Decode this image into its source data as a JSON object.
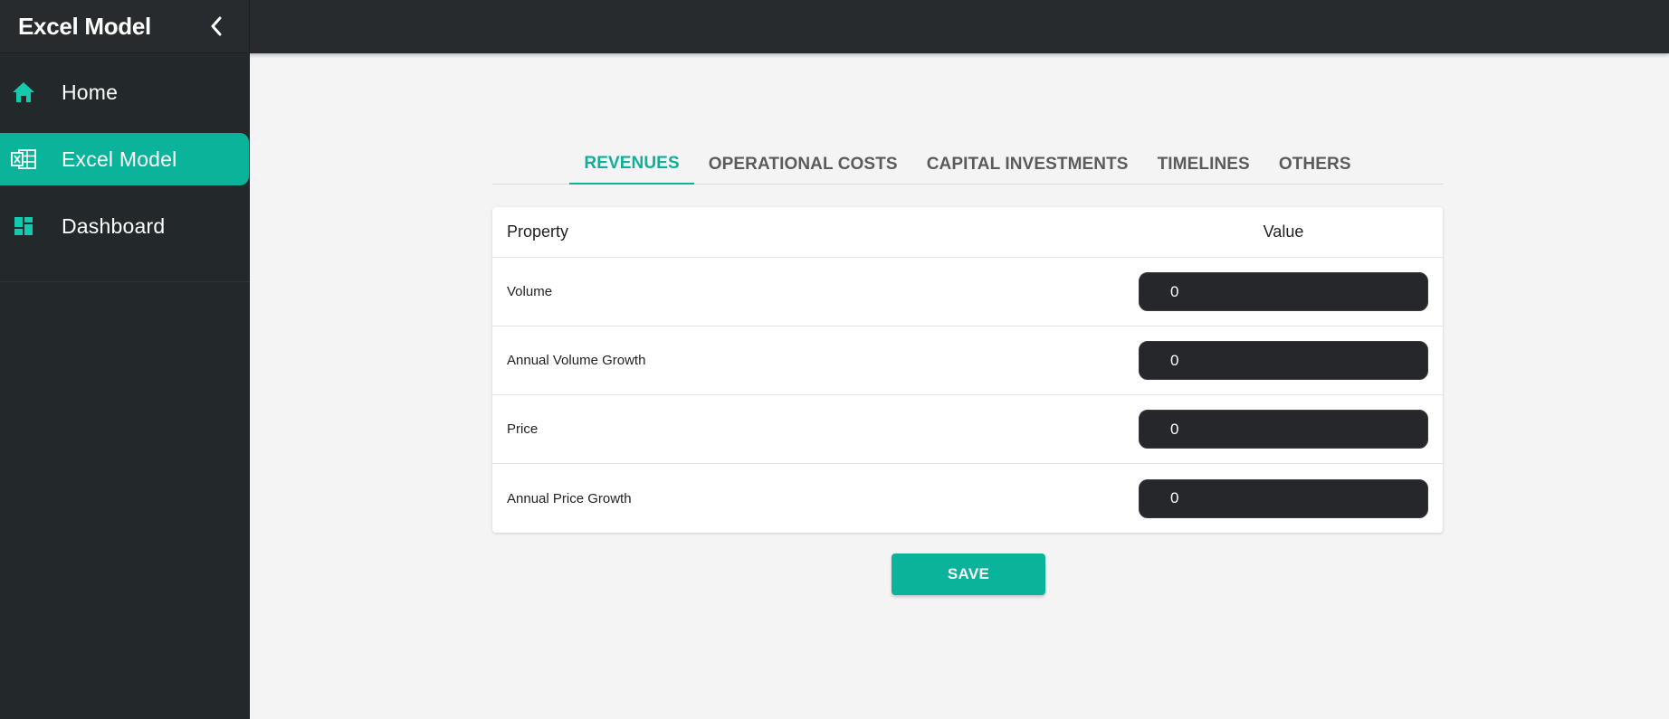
{
  "app": {
    "title": "Excel Model"
  },
  "sidebar": {
    "items": [
      {
        "label": "Home",
        "icon": "home-icon",
        "active": false
      },
      {
        "label": "Excel Model",
        "icon": "excel-icon",
        "active": true
      },
      {
        "label": "Dashboard",
        "icon": "dashboard-icon",
        "active": false
      }
    ]
  },
  "tabs": [
    {
      "label": "REVENUES",
      "active": true
    },
    {
      "label": "OPERATIONAL COSTS",
      "active": false
    },
    {
      "label": "CAPITAL INVESTMENTS",
      "active": false
    },
    {
      "label": "TIMELINES",
      "active": false
    },
    {
      "label": "OTHERS",
      "active": false
    }
  ],
  "table": {
    "headers": {
      "property": "Property",
      "value": "Value"
    },
    "rows": [
      {
        "property": "Volume",
        "value": "0"
      },
      {
        "property": "Annual Volume Growth",
        "value": "0"
      },
      {
        "property": "Price",
        "value": "0"
      },
      {
        "property": "Annual Price Growth",
        "value": "0"
      }
    ]
  },
  "actions": {
    "save_label": "SAVE"
  },
  "colors": {
    "accent": "#0cb39b",
    "sidebar_bg": "#23282a",
    "topbar_bg": "#272b2d",
    "page_bg": "#f4f4f4",
    "input_bg": "#26272b"
  }
}
